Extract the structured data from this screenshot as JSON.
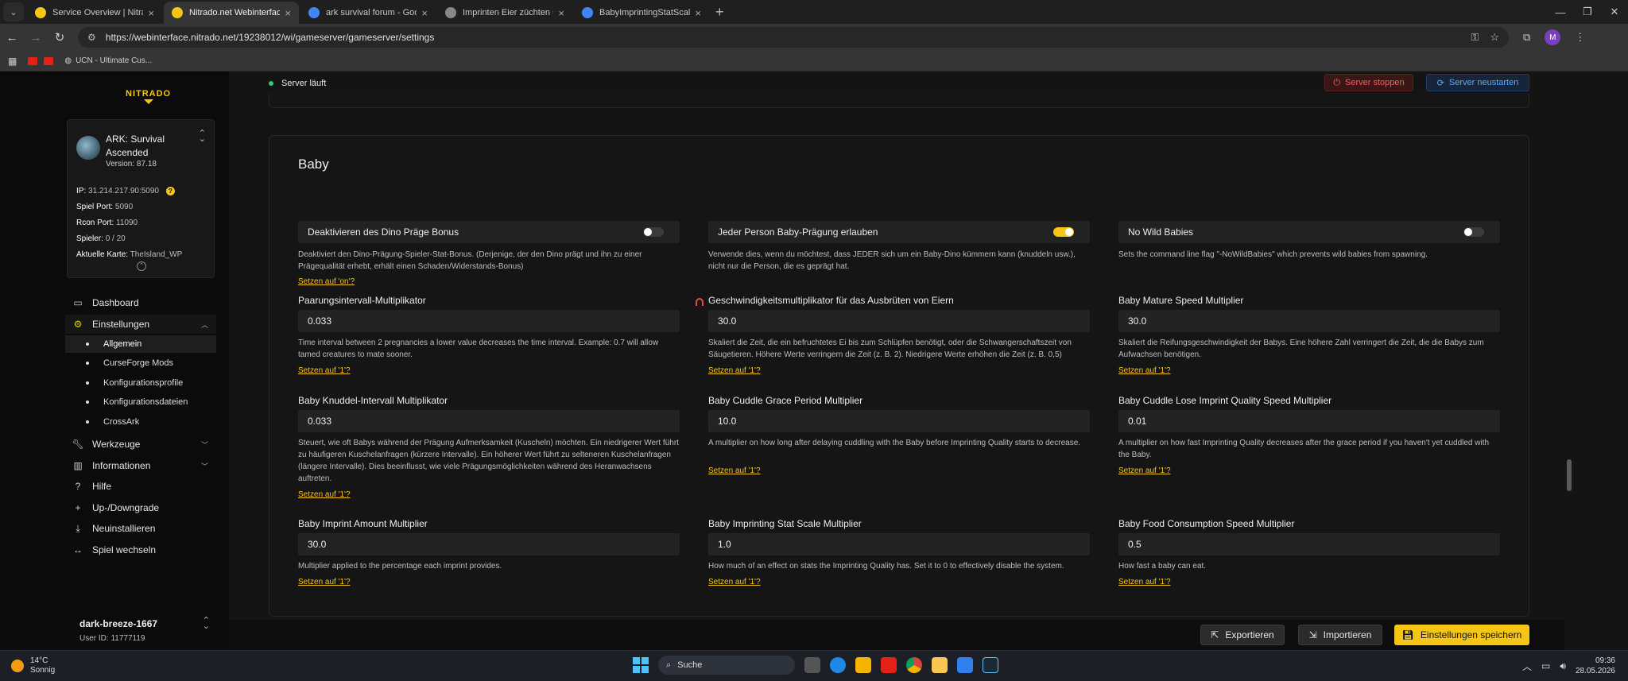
{
  "browser": {
    "tabs": [
      {
        "label": "Service Overview | Nitrado | Nit",
        "fav_color": "#f5c518",
        "active": false
      },
      {
        "label": "Nitrado.net Webinterface",
        "fav_color": "#f5c518",
        "active": true
      },
      {
        "label": "ark survival forum - Google Su",
        "fav_color": "#4285f4",
        "active": false
      },
      {
        "label": "Imprinten Eier züchten und Sch",
        "fav_color": "#888888",
        "active": false
      },
      {
        "label": "BabyImprintingStatScaleMultipl",
        "fav_color": "#4285f4",
        "active": false
      }
    ],
    "url": "https://webinterface.nitrado.net/19238012/wi/gameserver/gameserver/settings",
    "bookmark_label": "UCN - Ultimate Cus...",
    "profile_initial": "M"
  },
  "sidebar": {
    "logo": "NITRADO",
    "server": {
      "name": "ARK: Survival Ascended",
      "version": "Version: 87.18",
      "ip_label": "IP:",
      "ip_value": "31.214.217.90:5090",
      "game_port_label": "Spiel Port:",
      "game_port_value": "5090",
      "rcon_label": "Rcon Port:",
      "rcon_value": "11090",
      "players_label": "Spieler:",
      "players_value": "0 / 20",
      "map_label": "Aktuelle Karte:",
      "map_value": "TheIsland_WP"
    },
    "nav": {
      "dashboard": "Dashboard",
      "settings": "Einstellungen",
      "sub": [
        "Allgemein",
        "CurseForge Mods",
        "Konfigurationsprofile",
        "Konfigurationsdateien",
        "CrossArk"
      ],
      "tools": "Werkzeuge",
      "info": "Informationen",
      "help": "Hilfe",
      "upgrade": "Up-/Downgrade",
      "reinstall": "Neuinstallieren",
      "switch_game": "Spiel wechseln"
    },
    "user": {
      "name": "dark-breeze-1667",
      "id": "User ID: 11777119"
    }
  },
  "main": {
    "status": "Server läuft",
    "stop_button": "Server stoppen",
    "restart_button": "Server neustarten",
    "section_title": "Baby",
    "toggles": [
      {
        "label": "Deaktivieren des Dino Präge Bonus",
        "on": false,
        "desc": "Deaktiviert den Dino-Prägung-Spieler-Stat-Bonus. (Derjenige, der den Dino prägt und ihn zu einer Prägequalität erhebt, erhält einen Schaden/Widerstands-Bonus)",
        "reset": "Setzen auf 'on'?"
      },
      {
        "label": "Jeder Person Baby-Prägung erlauben",
        "on": true,
        "desc": "Verwende dies, wenn du möchtest, dass JEDER sich um ein Baby-Dino kümmern kann (knuddeln usw.), nicht nur die Person, die es geprägt hat.",
        "reset": ""
      },
      {
        "label": "No Wild Babies",
        "on": false,
        "desc": "Sets the command line flag \"-NoWildBabies\" which prevents wild babies from spawning.",
        "reset": ""
      }
    ],
    "fields": [
      {
        "label": "Paarungsintervall-Multiplikator",
        "value": "0.033",
        "desc": "Time interval between 2 pregnancies a lower value decreases the time interval. Example: 0.7 will allow tamed creatures to mate sooner.",
        "reset": "Setzen auf '1'?"
      },
      {
        "label": "Geschwindigkeitsmultiplikator für das Ausbrüten von Eiern",
        "value": "30.0",
        "desc": "Skaliert die Zeit, die ein befruchtetes Ei bis zum Schlüpfen benötigt, oder die Schwangerschaftszeit von Säugetieren. Höhere Werte verringern die Zeit (z. B. 2). Niedrigere Werte erhöhen die Zeit (z. B. 0,5)",
        "reset": "Setzen auf '1'?"
      },
      {
        "label": "Baby Mature Speed Multiplier",
        "value": "30.0",
        "desc": "Skaliert die Reifungsgeschwindigkeit der Babys. Eine höhere Zahl verringert die Zeit, die die Babys zum Aufwachsen benötigen.",
        "reset": "Setzen auf '1'?"
      },
      {
        "label": "Baby Knuddel-Intervall Multiplikator",
        "value": "0.033",
        "desc": "Steuert, wie oft Babys während der Prägung Aufmerksamkeit (Kuscheln) möchten. Ein niedrigerer Wert führt zu häufigeren Kuschelanfragen (kürzere Intervalle). Ein höherer Wert führt zu selteneren Kuschelanfragen (längere Intervalle). Dies beeinflusst, wie viele Prägungsmöglichkeiten während des Heranwachsens auftreten.",
        "reset": "Setzen auf '1'?"
      },
      {
        "label": "Baby Cuddle Grace Period Multiplier",
        "value": "10.0",
        "desc": "A multiplier on how long after delaying cuddling with the Baby before Imprinting Quality starts to decrease.",
        "reset": "Setzen auf '1'?"
      },
      {
        "label": "Baby Cuddle Lose Imprint Quality Speed Multiplier",
        "value": "0.01",
        "desc": "A multiplier on how fast Imprinting Quality decreases after the grace period if you haven't yet cuddled with the Baby.",
        "reset": "Setzen auf '1'?"
      },
      {
        "label": "Baby Imprint Amount Multiplier",
        "value": "30.0",
        "desc": "Multiplier applied to the percentage each imprint provides.",
        "reset": "Setzen auf '1'?"
      },
      {
        "label": "Baby Imprinting Stat Scale Multiplier",
        "value": "1.0",
        "desc": "How much of an effect on stats the Imprinting Quality has. Set it to 0 to effectively disable the system.",
        "reset": "Setzen auf '1'?"
      },
      {
        "label": "Baby Food Consumption Speed Multiplier",
        "value": "0.5",
        "desc": "How fast a baby can eat.",
        "reset": "Setzen auf '1'?"
      }
    ],
    "export_button": "Exportieren",
    "import_button": "Importieren",
    "save_button": "Einstellungen speichern"
  },
  "taskbar": {
    "temp": "14°C",
    "weather": "Sonnig",
    "search": "Suche",
    "time": "09:36",
    "date": "28.05.2026"
  },
  "colors": {
    "accent": "#f5c518",
    "stop": "#ff5a5a",
    "restart": "#5aa9ff",
    "online": "#2ecc71"
  }
}
